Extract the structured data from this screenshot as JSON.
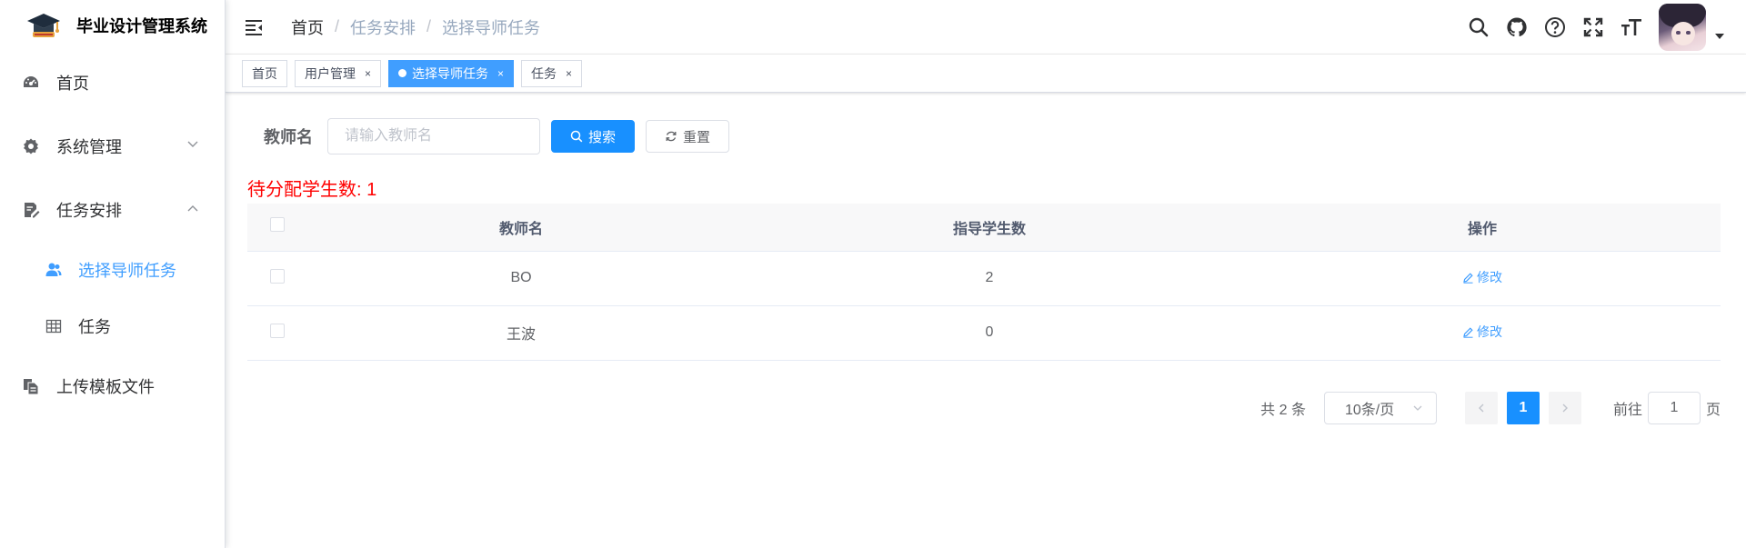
{
  "app": {
    "title": "毕业设计管理系统"
  },
  "sidebar": {
    "items": [
      {
        "label": "首页",
        "icon": "dashboard-icon"
      },
      {
        "label": "系统管理",
        "icon": "gear-icon"
      },
      {
        "label": "任务安排",
        "icon": "document-edit-icon"
      },
      {
        "label": "上传模板文件",
        "icon": "copy-file-icon"
      }
    ],
    "sub_items": [
      {
        "label": "选择导师任务",
        "icon": "users-icon",
        "active": true
      },
      {
        "label": "任务",
        "icon": "table-icon"
      }
    ]
  },
  "breadcrumb": {
    "items": [
      "首页",
      "任务安排",
      "选择导师任务"
    ],
    "separator": "/"
  },
  "tags": [
    {
      "label": "首页"
    },
    {
      "label": "用户管理",
      "close": "×"
    },
    {
      "label": "选择导师任务",
      "close": "×",
      "active": true
    },
    {
      "label": "任务",
      "close": "×"
    }
  ],
  "search": {
    "label": "教师名",
    "placeholder": "请输入教师名",
    "value": "",
    "search_button": "搜索",
    "reset_button": "重置"
  },
  "pending": {
    "text": "待分配学生数: 1"
  },
  "table": {
    "columns": [
      "教师名",
      "指导学生数",
      "操作"
    ],
    "rows": [
      {
        "teacher": "BO",
        "count": "2",
        "action": "修改"
      },
      {
        "teacher": "王波",
        "count": "0",
        "action": "修改"
      }
    ]
  },
  "pagination": {
    "total": "共 2 条",
    "page_size": "10条/页",
    "current_page": "1",
    "goto_label": "前往",
    "goto_value": "1",
    "page_suffix": "页"
  },
  "colors": {
    "primary": "#1890ff",
    "accent": "#409eff",
    "warning_text": "#ff0000"
  }
}
